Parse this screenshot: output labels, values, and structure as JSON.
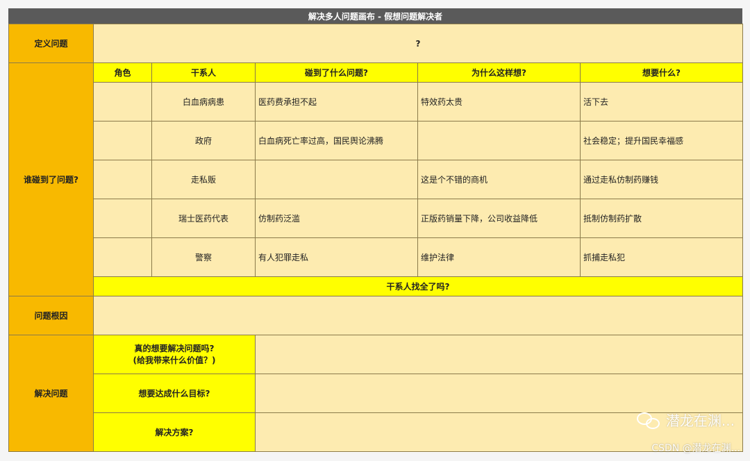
{
  "title": "解决多人问题画布 - 假想问题解决者",
  "define": {
    "label": "定义问题",
    "value": "?"
  },
  "who": {
    "label": "谁碰到了问题?",
    "headers": [
      "角色",
      "干系人",
      "碰到了什么问题?",
      "为什么这样想?",
      "想要什么?"
    ],
    "rows": [
      {
        "role": "",
        "stakeholder": "白血病病患",
        "problem": "医药费承担不起",
        "why": "特效药太贵",
        "want": "活下去"
      },
      {
        "role": "",
        "stakeholder": "政府",
        "problem": "白血病死亡率过高，国民舆论沸腾",
        "why": "",
        "want": "社会稳定；提升国民幸福感"
      },
      {
        "role": "",
        "stakeholder": "走私贩",
        "problem": "",
        "why": "这是个不错的商机",
        "want": "通过走私仿制药赚钱"
      },
      {
        "role": "",
        "stakeholder": "瑞士医药代表",
        "problem": "仿制药泛滥",
        "why": "正版药销量下降，公司收益降低",
        "want": "抵制仿制药扩散"
      },
      {
        "role": "",
        "stakeholder": "警察",
        "problem": "有人犯罪走私",
        "why": "维护法律",
        "want": "抓捕走私犯"
      }
    ],
    "footer": "干系人找全了吗?"
  },
  "root_cause": {
    "label": "问题根因",
    "value": ""
  },
  "solve": {
    "label": "解决问题",
    "items": [
      {
        "line1": "真的想要解决问题吗?",
        "line2": "(给我带来什么价值？)",
        "value": ""
      },
      {
        "line1": "想要达成什么目标?",
        "line2": "",
        "value": ""
      },
      {
        "line1": "解决方案?",
        "line2": "",
        "value": ""
      }
    ]
  },
  "watermark": {
    "brand": "潜龙在渊...",
    "csdn": "CSDN @潜龙在渊..."
  }
}
